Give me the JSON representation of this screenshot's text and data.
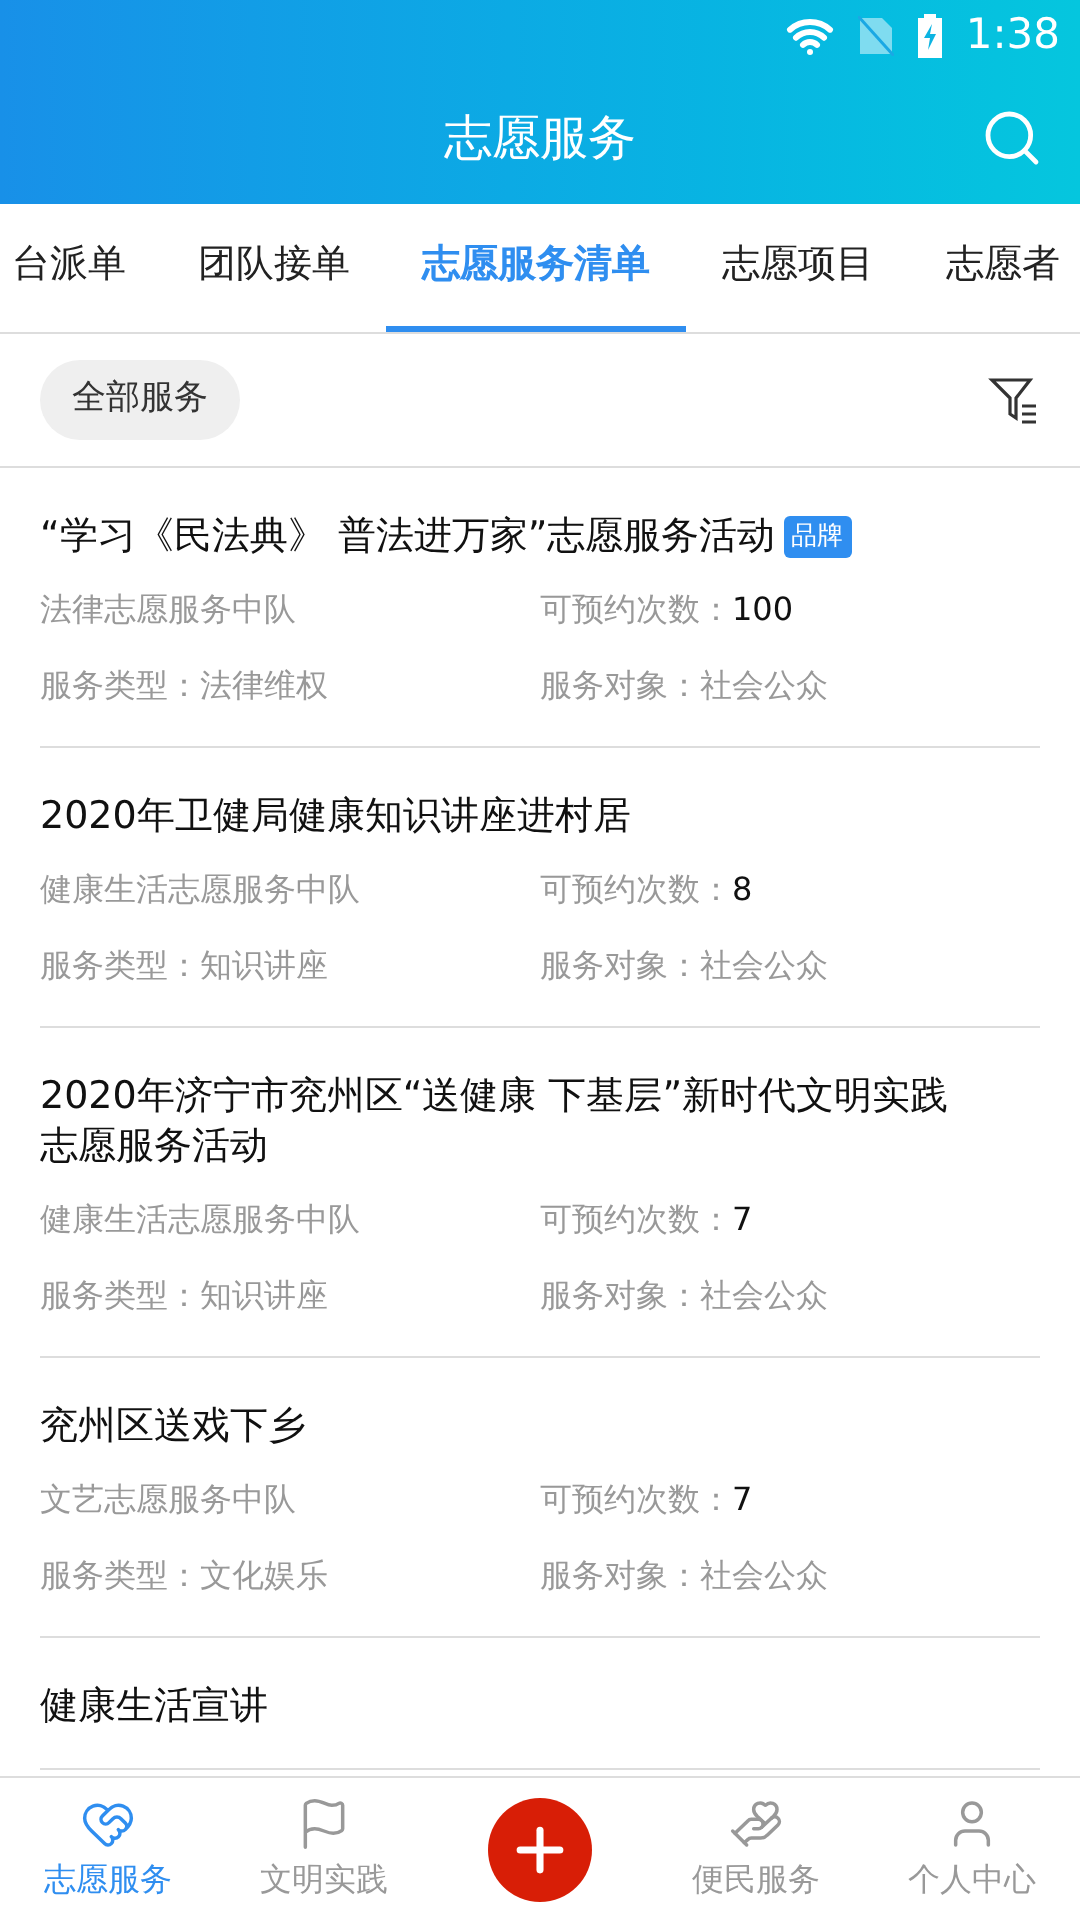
{
  "status_bar": {
    "time": "1:38"
  },
  "header": {
    "title": "志愿服务"
  },
  "tabs": [
    {
      "label": "台派单",
      "selected": false
    },
    {
      "label": "团队接单",
      "selected": false
    },
    {
      "label": "志愿服务清单",
      "selected": true
    },
    {
      "label": "志愿项目",
      "selected": false
    },
    {
      "label": "志愿者",
      "selected": false
    }
  ],
  "filter": {
    "chip": "全部服务"
  },
  "items": [
    {
      "title": "“学习《民法典》 普法进万家”志愿服务活动",
      "badge": "品牌",
      "team": "法律志愿服务中队",
      "count_label": "可预约次数：",
      "count": "100",
      "type": "服务类型：法律维权",
      "target": "服务对象：社会公众"
    },
    {
      "title": "2020年卫健局健康知识讲座进村居",
      "team": "健康生活志愿服务中队",
      "count_label": "可预约次数：",
      "count": "8",
      "type": "服务类型：知识讲座",
      "target": "服务对象：社会公众"
    },
    {
      "title": "2020年济宁市兖州区“送健康 下基层”新时代文明实践志愿服务活动",
      "team": "健康生活志愿服务中队",
      "count_label": "可预约次数：",
      "count": "7",
      "type": "服务类型：知识讲座",
      "target": "服务对象：社会公众"
    },
    {
      "title": "兖州区送戏下乡",
      "team": "文艺志愿服务中队",
      "count_label": "可预约次数：",
      "count": "7",
      "type": "服务类型：文化娱乐",
      "target": "服务对象：社会公众"
    },
    {
      "title": "健康生活宣讲"
    }
  ],
  "bottom_nav": [
    {
      "kind": "volunteer",
      "label": "志愿服务",
      "selected": true
    },
    {
      "kind": "flag",
      "label": "文明实践",
      "selected": false
    },
    {
      "kind": "add"
    },
    {
      "kind": "care",
      "label": "便民服务",
      "selected": false
    },
    {
      "kind": "person",
      "label": "个人中心",
      "selected": false
    }
  ]
}
